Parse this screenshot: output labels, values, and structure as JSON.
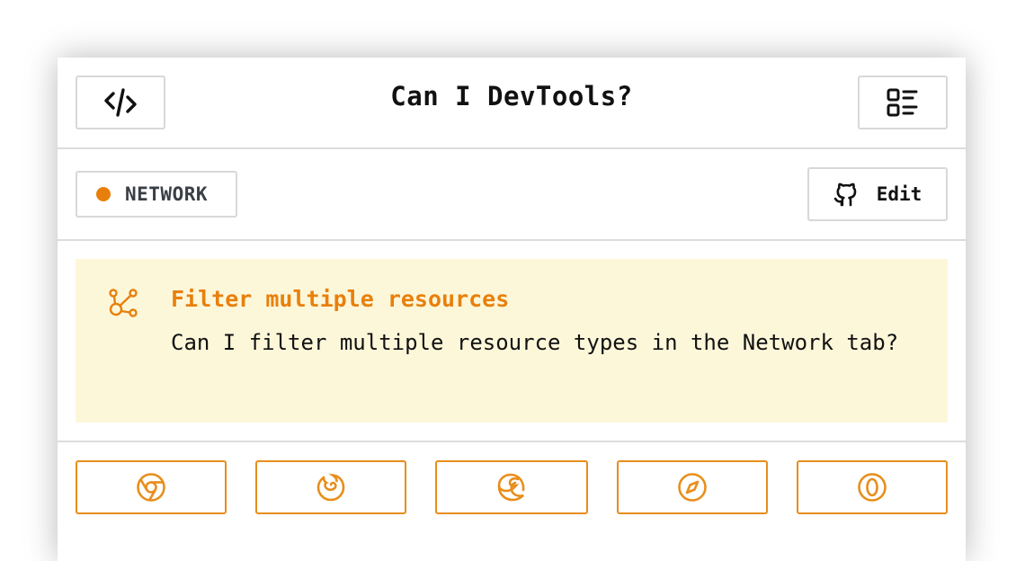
{
  "header": {
    "title": "Can I DevTools?",
    "left_icon": "code-icon",
    "right_icon": "list-icon"
  },
  "category": {
    "label": "NETWORK",
    "color": "#e87f0c"
  },
  "edit": {
    "label": "Edit",
    "icon": "github-icon"
  },
  "feature": {
    "icon": "network-icon",
    "title": "Filter multiple resources",
    "description": "Can I filter multiple resource types in the Network tab?",
    "title_color": "#e8800c",
    "background": "#fdf7da"
  },
  "browsers": [
    {
      "name": "chrome",
      "icon": "chrome-icon"
    },
    {
      "name": "firefox",
      "icon": "firefox-icon"
    },
    {
      "name": "edge",
      "icon": "edge-icon"
    },
    {
      "name": "safari",
      "icon": "safari-icon"
    },
    {
      "name": "opera",
      "icon": "opera-icon"
    }
  ],
  "accent": "#e88e1b"
}
